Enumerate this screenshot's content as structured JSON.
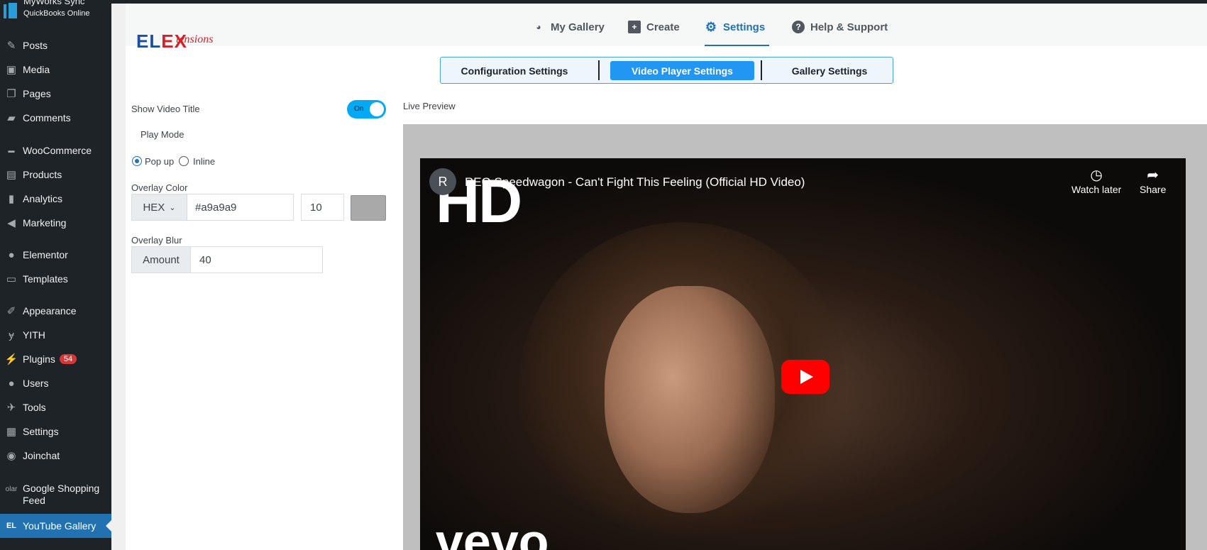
{
  "sidebar": {
    "top_title": "MyWorks Sync",
    "top_subtitle": "QuickBooks Online",
    "items": [
      {
        "label": "Posts",
        "icon": "pin-icon"
      },
      {
        "label": "Media",
        "icon": "media-icon"
      },
      {
        "label": "Pages",
        "icon": "pages-icon"
      },
      {
        "label": "Comments",
        "icon": "comment-icon"
      },
      {
        "label": "WooCommerce",
        "icon": "woo-icon"
      },
      {
        "label": "Products",
        "icon": "products-icon"
      },
      {
        "label": "Analytics",
        "icon": "bar-chart-icon"
      },
      {
        "label": "Marketing",
        "icon": "megaphone-icon"
      },
      {
        "label": "Elementor",
        "icon": "elementor-icon"
      },
      {
        "label": "Templates",
        "icon": "folder-icon"
      },
      {
        "label": "Appearance",
        "icon": "brush-icon"
      },
      {
        "label": "YITH",
        "icon": "yith-icon"
      },
      {
        "label": "Plugins",
        "icon": "plugin-icon",
        "badge": "54"
      },
      {
        "label": "Users",
        "icon": "user-icon"
      },
      {
        "label": "Tools",
        "icon": "wrench-icon"
      },
      {
        "label": "Settings",
        "icon": "settings-icon"
      },
      {
        "label": "Joinchat",
        "icon": "whatsapp-icon"
      },
      {
        "label": "Google Shopping Feed",
        "icon": "olar-icon"
      },
      {
        "label": "YouTube Gallery",
        "icon": "elex-icon",
        "active": true
      }
    ],
    "google_icon_text": "olar",
    "elex_icon_text": "EL"
  },
  "header": {
    "logo_el": "EL",
    "logo_ex": "EX",
    "logo_tensions": "tensions",
    "nav": [
      {
        "label": "My Gallery",
        "icon": "palette-icon"
      },
      {
        "label": "Create",
        "icon": "plus-icon"
      },
      {
        "label": "Settings",
        "icon": "gear-icon",
        "active": true
      },
      {
        "label": "Help & Support",
        "icon": "help-icon"
      }
    ]
  },
  "tabs": [
    {
      "label": "Configuration Settings"
    },
    {
      "label": "Video Player Settings",
      "active": true
    },
    {
      "label": "Gallery Settings"
    }
  ],
  "settings": {
    "show_title_label": "Show Video Title",
    "toggle_text": "On",
    "toggle_on": true,
    "play_mode_label": "Play Mode",
    "popup_label": "Pop up",
    "inline_label": "Inline",
    "play_mode_value": "popup",
    "overlay_color_label": "Overlay Color",
    "color_format": "HEX",
    "color_value": "#a9a9a9",
    "opacity_value": "10",
    "overlay_blur_label": "Overlay Blur",
    "amount_label": "Amount",
    "amount_value": "40"
  },
  "preview": {
    "label": "Live Preview",
    "channel_initial": "R",
    "video_title": "REO Speedwagon - Can't Fight This Feeling (Official HD Video)",
    "watch_later": "Watch later",
    "share": "Share",
    "hd_text": "HD",
    "vevo_text": "vevo"
  },
  "colors": {
    "sidebar_bg": "#1d2327",
    "accent": "#2271b1",
    "tab_active": "#2196f3",
    "toggle": "#03a9f4",
    "swatch": "#a9a9a9",
    "youtube_red": "#ff0000"
  }
}
